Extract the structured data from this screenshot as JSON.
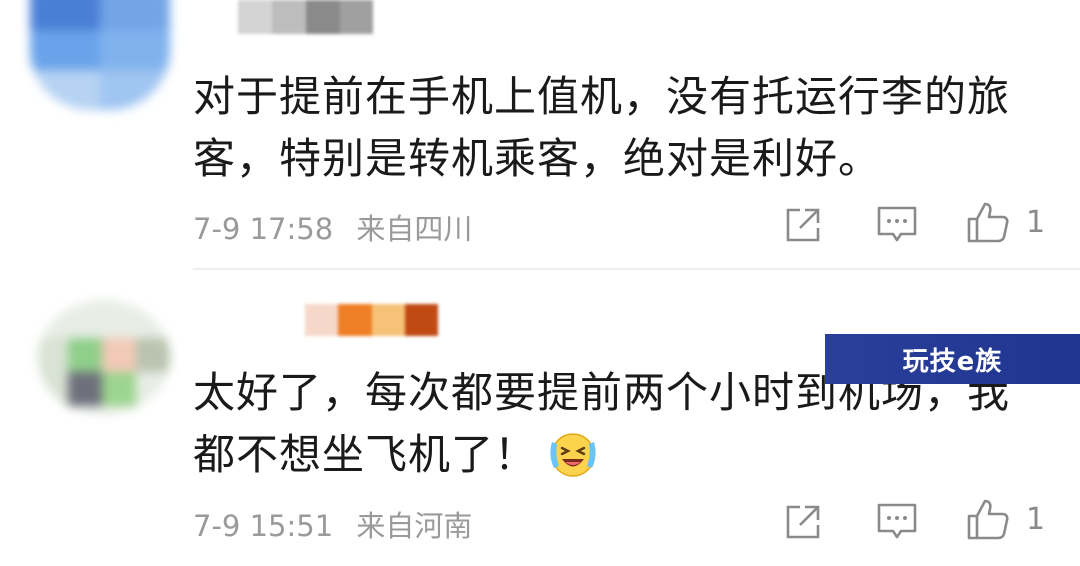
{
  "comments": [
    {
      "text": "对于提前在手机上值机，没有托运行李的旅客，特别是转机乘客，绝对是利好。",
      "time": "7-9 17:58",
      "location": "来自四川",
      "likes": "1"
    },
    {
      "text": "太好了，每次都要提前两个小时到机场，我都不想坐飞机了！",
      "time": "7-9 15:51",
      "location": "来自河南",
      "likes": "1",
      "emoji": "laughing-crying-emoji"
    }
  ],
  "watermark": {
    "text": "玩技e族"
  },
  "icons": {
    "share": "share-icon",
    "reply": "comment-icon",
    "like": "thumbs-up-icon"
  },
  "colors": {
    "text": "#1a1a1a",
    "meta": "#9a9a9a",
    "icon": "#8a8a8a",
    "watermark_bg": "#2a3f99"
  }
}
